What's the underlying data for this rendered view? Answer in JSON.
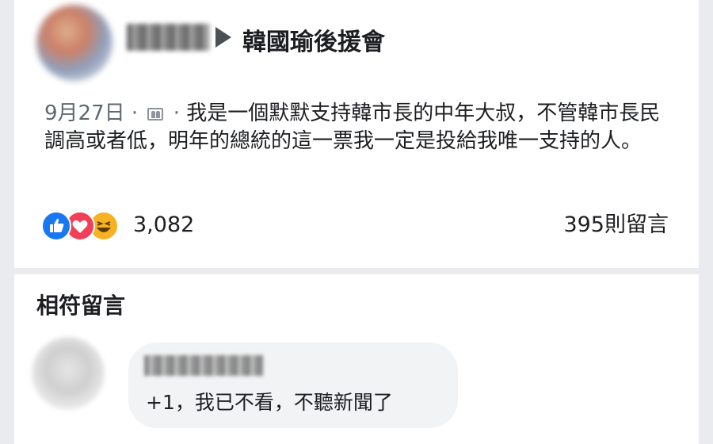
{
  "post": {
    "group_name": "韓國瑜後援會",
    "date": "9月27日",
    "separator": "·",
    "audience_icon": "group-icon",
    "text": "我是一個默默支持韓市長的中年大叔，不管韓市長民調高或者低，明年的總統的這一票我一定是投給我唯一支持的人。",
    "reactions": [
      "like",
      "love",
      "haha"
    ],
    "reaction_count": "3,082",
    "comment_count": "395則留言"
  },
  "comments_section": {
    "title": "相符留言",
    "comments": [
      {
        "text": "+1，我已不看，不聽新聞了"
      }
    ]
  },
  "colors": {
    "like": "#1877f2",
    "love": "#f33e58",
    "haha": "#f7b125",
    "background": "#e9ebee",
    "bubble": "#f2f3f5"
  }
}
